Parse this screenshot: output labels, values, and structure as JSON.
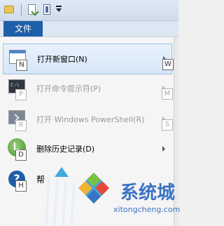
{
  "file_tab": {
    "label": "文件"
  },
  "menu": {
    "items": [
      {
        "label": "打开新窗口(N)",
        "keytip_left": "N",
        "keytip_right": "W",
        "disabled": false
      },
      {
        "label": "打开命令提示符(P)",
        "keytip_left": "P",
        "keytip_right": "M",
        "disabled": true
      },
      {
        "label": "打开 Windows PowerShell(R)",
        "keytip_left": "R",
        "keytip_right": "S",
        "disabled": true
      },
      {
        "label": "删除历史记录(D)",
        "keytip_left": "D",
        "keytip_right": "",
        "disabled": false
      },
      {
        "label": "帮",
        "keytip_left": "H",
        "keytip_right": "",
        "disabled": false
      }
    ]
  },
  "watermark": {
    "brand": "系统城",
    "url": "xitongcheng.com"
  },
  "colors": {
    "accent": "#1f5ea8",
    "highlight_border": "#9fc2e8",
    "watermark": "#3a73c4"
  }
}
